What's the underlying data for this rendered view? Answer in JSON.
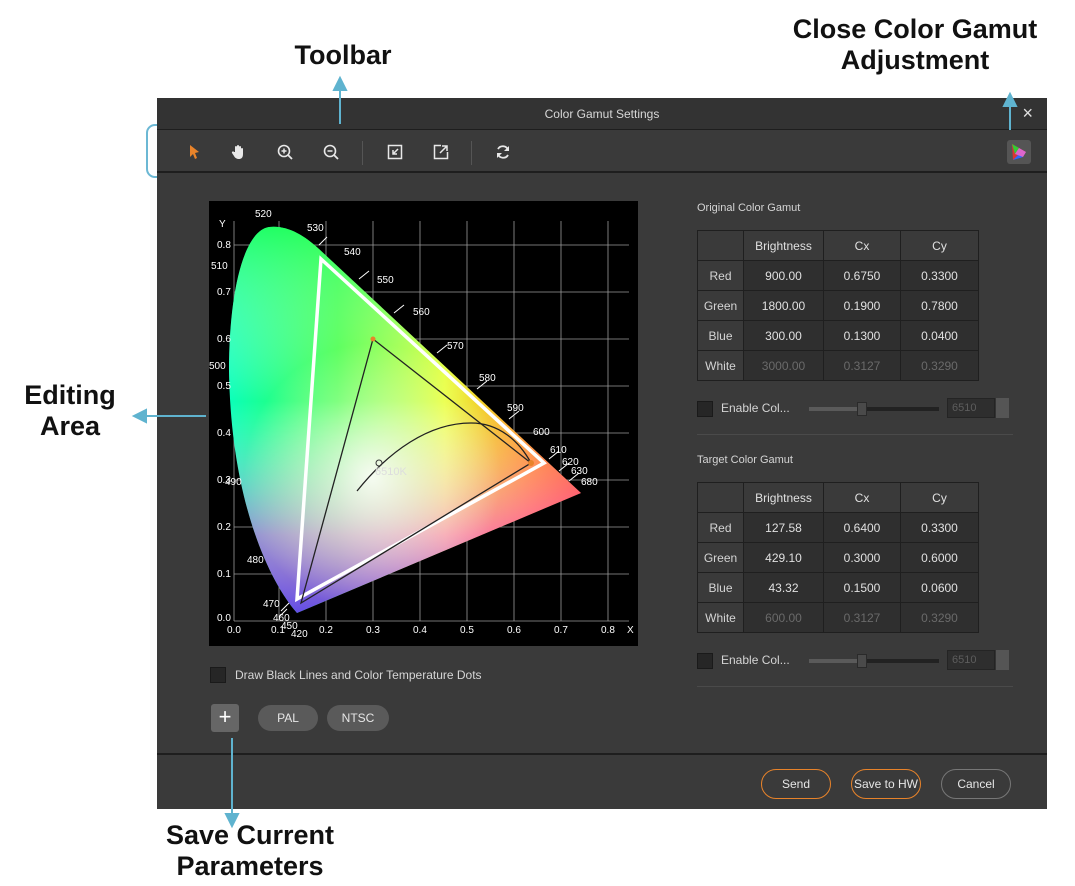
{
  "callouts": {
    "toolbar": "Toolbar",
    "close_gamut_line1": "Close Color Gamut",
    "close_gamut_line2": "Adjustment",
    "editing_line1": "Editing",
    "editing_line2": "Area",
    "save_line1": "Save Current",
    "save_line2": "Parameters"
  },
  "dialog": {
    "title": "Color Gamut Settings",
    "close_glyph": "×"
  },
  "toolbar": {
    "tools": [
      "pointer-icon",
      "hand-icon",
      "zoom-in-icon",
      "zoom-out-icon",
      "import-icon",
      "export-icon",
      "refresh-icon"
    ],
    "accent_color": "#e8832a"
  },
  "chart": {
    "y_axis_label": "Y",
    "x_axis_label": "X",
    "y_ticks": [
      "0.0",
      "0.1",
      "0.2",
      "0.3",
      "0.4",
      "0.5",
      "0.6",
      "0.7",
      "0.8"
    ],
    "x_ticks": [
      "0.0",
      "0.1",
      "0.2",
      "0.3",
      "0.4",
      "0.5",
      "0.6",
      "0.7",
      "0.8"
    ],
    "wavelength_labels": [
      "520",
      "530",
      "540",
      "550",
      "560",
      "570",
      "580",
      "590",
      "600",
      "610",
      "620",
      "630",
      "680",
      "510",
      "500",
      "490",
      "480",
      "470",
      "460",
      "450",
      "420"
    ],
    "white_point_label": "6510K"
  },
  "original_gamut": {
    "label": "Original Color Gamut",
    "headers": [
      "Brightness",
      "Cx",
      "Cy"
    ],
    "rows": [
      {
        "name": "Red",
        "brightness": "900.00",
        "cx": "0.6750",
        "cy": "0.3300"
      },
      {
        "name": "Green",
        "brightness": "1800.00",
        "cx": "0.1900",
        "cy": "0.7800"
      },
      {
        "name": "Blue",
        "brightness": "300.00",
        "cx": "0.1300",
        "cy": "0.0400"
      },
      {
        "name": "White",
        "brightness": "3000.00",
        "cx": "0.3127",
        "cy": "0.3290"
      }
    ],
    "enable_label": "Enable Col...",
    "temp_value": "6510"
  },
  "target_gamut": {
    "label": "Target Color Gamut",
    "headers": [
      "Brightness",
      "Cx",
      "Cy"
    ],
    "rows": [
      {
        "name": "Red",
        "brightness": "127.58",
        "cx": "0.6400",
        "cy": "0.3300"
      },
      {
        "name": "Green",
        "brightness": "429.10",
        "cx": "0.3000",
        "cy": "0.6000"
      },
      {
        "name": "Blue",
        "brightness": "43.32",
        "cx": "0.1500",
        "cy": "0.0600"
      },
      {
        "name": "White",
        "brightness": "600.00",
        "cx": "0.3127",
        "cy": "0.3290"
      }
    ],
    "enable_label": "Enable Col...",
    "temp_value": "6510"
  },
  "options": {
    "draw_lines_label": "Draw Black Lines and Color Temperature Dots",
    "add_glyph": "+",
    "presets": [
      "PAL",
      "NTSC"
    ]
  },
  "footer": {
    "send": "Send",
    "save_hw": "Save to HW",
    "cancel": "Cancel",
    "highlight_color": "#e8832a"
  }
}
